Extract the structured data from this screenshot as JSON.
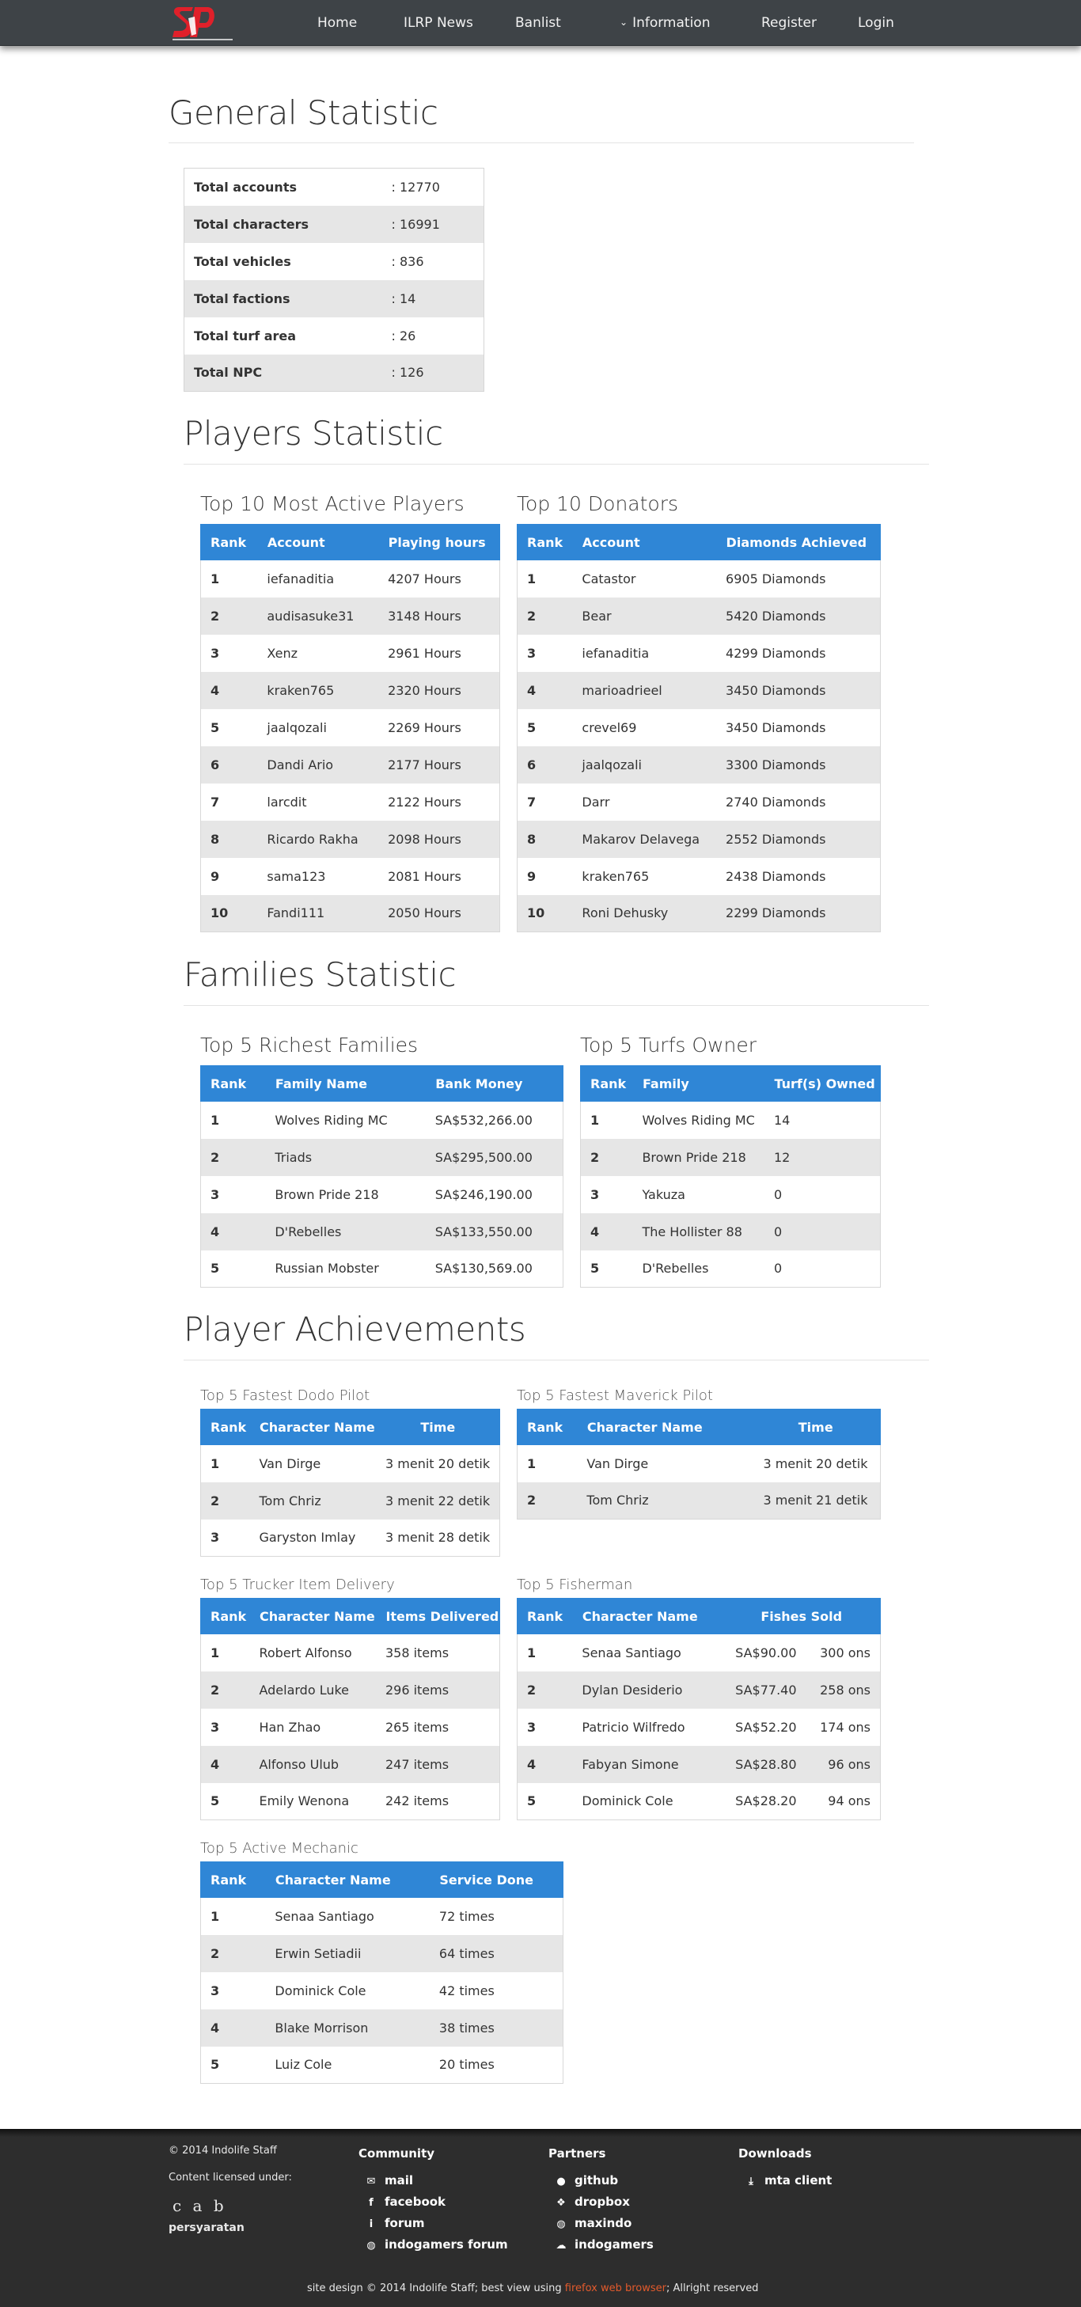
{
  "nav": {
    "items": [
      "Home",
      "ILRP News",
      "Banlist",
      "Information",
      "Register",
      "Login"
    ]
  },
  "general": {
    "title": "General Statistic",
    "rows": [
      {
        "label": "Total accounts",
        "value": ": 12770"
      },
      {
        "label": "Total characters",
        "value": ": 16991"
      },
      {
        "label": "Total vehicles",
        "value": ": 836"
      },
      {
        "label": "Total factions",
        "value": ": 14"
      },
      {
        "label": "Total turf area",
        "value": ": 26"
      },
      {
        "label": "Total NPC",
        "value": ": 126"
      }
    ]
  },
  "players": {
    "title": "Players Statistic",
    "active": {
      "title": "Top 10 Most Active Players",
      "headers": [
        "Rank",
        "Account",
        "Playing hours"
      ],
      "rows": [
        [
          "1",
          "iefanaditia",
          "4207 Hours"
        ],
        [
          "2",
          "audisasuke31",
          "3148 Hours"
        ],
        [
          "3",
          "Xenz",
          "2961 Hours"
        ],
        [
          "4",
          "kraken765",
          "2320 Hours"
        ],
        [
          "5",
          "jaalqozali",
          "2269 Hours"
        ],
        [
          "6",
          "Dandi Ario",
          "2177 Hours"
        ],
        [
          "7",
          "larcdit",
          "2122 Hours"
        ],
        [
          "8",
          "Ricardo Rakha",
          "2098 Hours"
        ],
        [
          "9",
          "sama123",
          "2081 Hours"
        ],
        [
          "10",
          "Fandi111",
          "2050 Hours"
        ]
      ]
    },
    "donators": {
      "title": "Top 10 Donators",
      "headers": [
        "Rank",
        "Account",
        "Diamonds Achieved"
      ],
      "rows": [
        [
          "1",
          "Catastor",
          "6905 Diamonds"
        ],
        [
          "2",
          "Bear",
          "5420 Diamonds"
        ],
        [
          "3",
          "iefanaditia",
          "4299 Diamonds"
        ],
        [
          "4",
          "marioadrieel",
          "3450 Diamonds"
        ],
        [
          "5",
          "crevel69",
          "3450 Diamonds"
        ],
        [
          "6",
          "jaalqozali",
          "3300 Diamonds"
        ],
        [
          "7",
          "Darr",
          "2740 Diamonds"
        ],
        [
          "8",
          "Makarov Delavega",
          "2552 Diamonds"
        ],
        [
          "9",
          "kraken765",
          "2438 Diamonds"
        ],
        [
          "10",
          "Roni Dehusky",
          "2299 Diamonds"
        ]
      ]
    }
  },
  "families": {
    "title": "Families Statistic",
    "richest": {
      "title": "Top 5 Richest Families",
      "headers": [
        "Rank",
        "Family Name",
        "Bank Money"
      ],
      "rows": [
        [
          "1",
          "Wolves Riding MC",
          "SA$532,266.00"
        ],
        [
          "2",
          "Triads",
          "SA$295,500.00"
        ],
        [
          "3",
          "Brown Pride 218",
          "SA$246,190.00"
        ],
        [
          "4",
          "D'Rebelles",
          "SA$133,550.00"
        ],
        [
          "5",
          "Russian Mobster",
          "SA$130,569.00"
        ]
      ]
    },
    "turfs": {
      "title": "Top 5 Turfs Owner",
      "headers": [
        "Rank",
        "Family",
        "Turf(s) Owned"
      ],
      "rows": [
        [
          "1",
          "Wolves Riding MC",
          "14"
        ],
        [
          "2",
          "Brown Pride 218",
          "12"
        ],
        [
          "3",
          "Yakuza",
          "0"
        ],
        [
          "4",
          "The Hollister 88",
          "0"
        ],
        [
          "5",
          "D'Rebelles",
          "0"
        ]
      ]
    }
  },
  "achievements": {
    "title": "Player Achievements",
    "dodo": {
      "title": "Top 5 Fastest Dodo Pilot",
      "headers": [
        "Rank",
        "Character Name",
        "Time"
      ],
      "rows": [
        [
          "1",
          "Van Dirge",
          "3 menit 20 detik"
        ],
        [
          "2",
          "Tom Chriz",
          "3 menit 22 detik"
        ],
        [
          "3",
          "Garyston Imlay",
          "3 menit 28 detik"
        ]
      ]
    },
    "maverick": {
      "title": "Top 5 Fastest Maverick Pilot",
      "headers": [
        "Rank",
        "Character Name",
        "Time"
      ],
      "rows": [
        [
          "1",
          "Van Dirge",
          "3 menit 20 detik"
        ],
        [
          "2",
          "Tom Chriz",
          "3 menit 21 detik"
        ]
      ]
    },
    "trucker": {
      "title": "Top 5 Trucker Item Delivery",
      "headers": [
        "Rank",
        "Character Name",
        "Items Delivered"
      ],
      "rows": [
        [
          "1",
          "Robert Alfonso",
          "358 items"
        ],
        [
          "2",
          "Adelardo Luke",
          "296 items"
        ],
        [
          "3",
          "Han Zhao",
          "265 items"
        ],
        [
          "4",
          "Alfonso Ulub",
          "247 items"
        ],
        [
          "5",
          "Emily Wenona",
          "242 items"
        ]
      ]
    },
    "fisherman": {
      "title": "Top 5 Fisherman",
      "headers": [
        "Rank",
        "Character Name",
        "Fishes Sold"
      ],
      "rows": [
        [
          "1",
          "Senaa Santiago",
          "SA$90.00",
          "300 ons"
        ],
        [
          "2",
          "Dylan Desiderio",
          "SA$77.40",
          "258 ons"
        ],
        [
          "3",
          "Patricio Wilfredo",
          "SA$52.20",
          "174 ons"
        ],
        [
          "4",
          "Fabyan Simone",
          "SA$28.80",
          "96 ons"
        ],
        [
          "5",
          "Dominick Cole",
          "SA$28.20",
          "94 ons"
        ]
      ]
    },
    "mechanic": {
      "title": "Top 5 Active Mechanic",
      "headers": [
        "Rank",
        "Character Name",
        "Service Done"
      ],
      "rows": [
        [
          "1",
          "Senaa Santiago",
          "72 times"
        ],
        [
          "2",
          "Erwin Setiadii",
          "64 times"
        ],
        [
          "3",
          "Dominick Cole",
          "42 times"
        ],
        [
          "4",
          "Blake Morrison",
          "38 times"
        ],
        [
          "5",
          "Luiz Cole",
          "20 times"
        ]
      ]
    }
  },
  "footer": {
    "copyright": "© 2014 Indolife Staff",
    "license_label": "Content licensed under:",
    "license_icons": "c a b",
    "terms": "persyaratan",
    "community": {
      "title": "Community",
      "links": [
        "mail",
        "facebook",
        "forum",
        "indogamers forum"
      ]
    },
    "partners": {
      "title": "Partners",
      "links": [
        "github",
        "dropbox",
        "maxindo",
        "indogamers"
      ]
    },
    "downloads": {
      "title": "Downloads",
      "links": [
        "mta client"
      ]
    },
    "bottom_pre": "site design © 2014 Indolife Staff; best view using ",
    "bottom_link": "firefox web browser",
    "bottom_post": "; Allright reserved"
  },
  "colors": {
    "accent": "#2f86d6",
    "navbar": "#3e4347",
    "footer": "#2d2d2d",
    "link": "#e25a2c",
    "logo_red": "#e0202a"
  }
}
